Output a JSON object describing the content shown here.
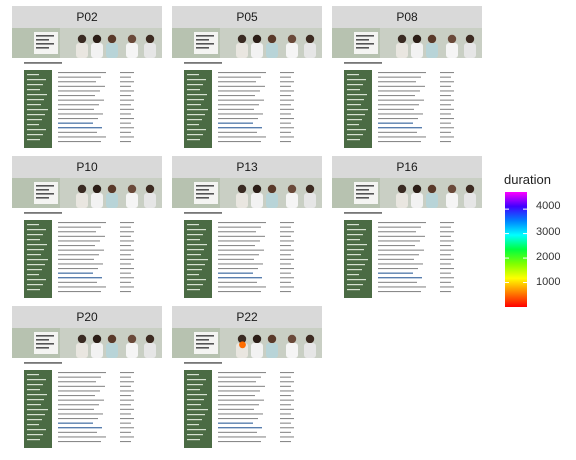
{
  "chart_data": {
    "type": "heatmap",
    "description_panels": [
      "P02",
      "P05",
      "P08",
      "P10",
      "P13",
      "P16",
      "P20",
      "P22"
    ],
    "panels": [
      {
        "label": "P02",
        "points": []
      },
      {
        "label": "P05",
        "points": []
      },
      {
        "label": "P08",
        "points": []
      },
      {
        "label": "P10",
        "points": []
      },
      {
        "label": "P13",
        "points": []
      },
      {
        "label": "P16",
        "points": []
      },
      {
        "label": "P20",
        "points": []
      },
      {
        "label": "P22",
        "points": [
          {
            "x": 0.47,
            "y": 0.14,
            "duration": 400
          }
        ]
      }
    ],
    "legend": {
      "title": "duration",
      "ticks": [
        1000,
        2000,
        3000,
        4000
      ],
      "range": [
        0,
        4700
      ],
      "colors": [
        "#ff0000",
        "#ff8000",
        "#ffff00",
        "#00ff00",
        "#00ffff",
        "#0080ff",
        "#0000ff",
        "#8000ff",
        "#ff00ff"
      ]
    }
  },
  "legend": {
    "title": "duration",
    "tick_labels": [
      "4000",
      "3000",
      "2000",
      "1000"
    ]
  },
  "page_mock": {
    "header_text_lines": [
      "",
      "",
      ""
    ],
    "body_caption": ""
  }
}
